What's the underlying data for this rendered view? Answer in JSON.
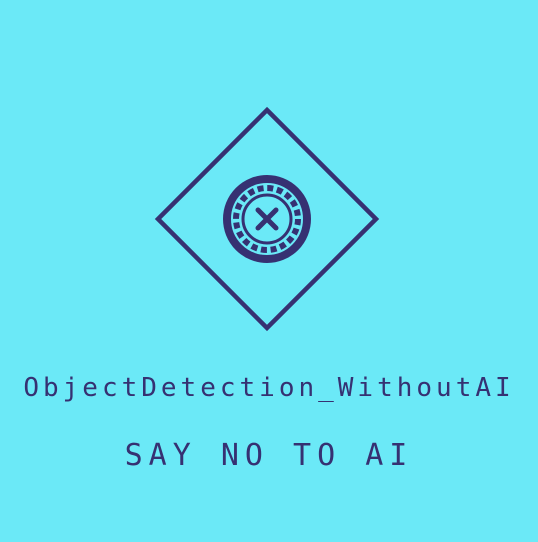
{
  "brand": {
    "title": "ObjectDetection_WithoutAI",
    "tagline": "SAY NO TO AI"
  },
  "colors": {
    "background": "#6BE9F7",
    "primary": "#363172"
  },
  "icons": {
    "frame": "diamond-frame-icon",
    "emblem": "roulette-wheel-icon",
    "cross": "cross-icon"
  }
}
